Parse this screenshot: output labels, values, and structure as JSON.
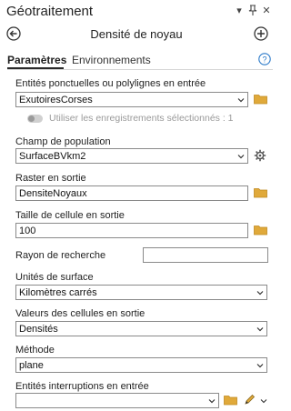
{
  "header": {
    "app_title": "Géotraitement",
    "pin_glyph": "▾",
    "pin2_glyph": "ᵠ",
    "close_glyph": "✕"
  },
  "nav": {
    "tool_title": "Densité de noyau"
  },
  "tabs": [
    {
      "label": "Paramètres",
      "active": true
    },
    {
      "label": "Environnements",
      "active": false
    }
  ],
  "params": {
    "input_features": {
      "label": "Entités ponctuelles ou polylignes en entrée",
      "value": "ExutoiresCorses"
    },
    "use_selected": {
      "label": "Utiliser les enregistrements sélectionnés : 1",
      "checked": false
    },
    "population_field": {
      "label": "Champ de population",
      "value": "SurfaceBVkm2"
    },
    "output_raster": {
      "label": "Raster en sortie",
      "value": "DensiteNoyaux"
    },
    "cell_size": {
      "label": "Taille de cellule en sortie",
      "value": "100"
    },
    "search_radius": {
      "label": "Rayon de recherche",
      "value": ""
    },
    "area_units": {
      "label": "Unités de surface",
      "value": "Kilomètres carrés"
    },
    "output_values": {
      "label": "Valeurs des cellules en sortie",
      "value": "Densités"
    },
    "method": {
      "label": "Méthode",
      "value": "plane"
    },
    "barriers": {
      "label": "Entités interruptions en entrée",
      "value": ""
    }
  },
  "icons": {
    "back": "back-arrow-icon",
    "add": "add-icon",
    "help": "help-icon",
    "folder": "folder-icon",
    "gear": "gear-icon",
    "pencil": "pencil-icon",
    "chevron": "chevron-down-icon"
  },
  "colors": {
    "accent": "#2a79c9",
    "folder": "#e0a93a",
    "toggle_off": "#d0d0d0",
    "disabled_text": "#9a9a9a"
  }
}
